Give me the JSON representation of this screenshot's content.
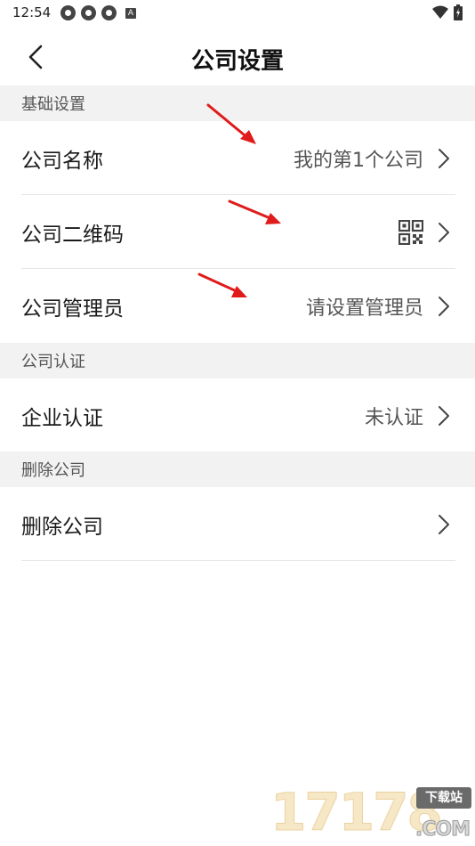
{
  "status_bar": {
    "time": "12:54",
    "icons": [
      "sync-icon",
      "sync-icon",
      "sync-icon",
      "a-badge-icon"
    ],
    "right_icons": [
      "wifi-icon",
      "battery-icon"
    ]
  },
  "header": {
    "title": "公司设置",
    "back_icon": "chevron-left-icon"
  },
  "sections": [
    {
      "title": "基础设置",
      "rows": [
        {
          "label": "公司名称",
          "value": "我的第1个公司"
        },
        {
          "label": "公司二维码",
          "value_icon": "qr-code-icon"
        },
        {
          "label": "公司管理员",
          "value": "请设置管理员"
        }
      ]
    },
    {
      "title": "公司认证",
      "rows": [
        {
          "label": "企业认证",
          "value": "未认证"
        }
      ]
    },
    {
      "title": "删除公司",
      "rows": [
        {
          "label": "删除公司",
          "value": ""
        }
      ]
    }
  ],
  "annotation": {
    "arrow_color": "#e01b1b",
    "count": 3
  },
  "watermark": {
    "digits": "17178",
    "tag": "下载站",
    "suffix": ".COM"
  }
}
